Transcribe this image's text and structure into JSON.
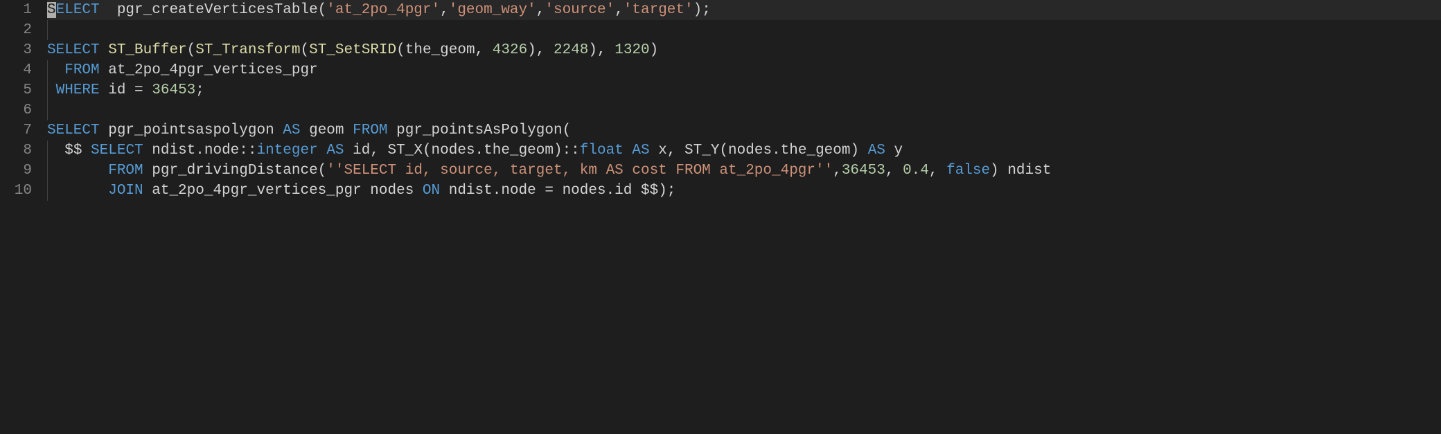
{
  "gutter": [
    "1",
    "2",
    "3",
    "4",
    "5",
    "6",
    "7",
    "8",
    "9",
    "10"
  ],
  "lines": {
    "l1": {
      "sel": "S",
      "t1": "ELECT",
      "t2": "  pgr_createVerticesTable(",
      "s1": "'at_2po_4pgr'",
      "c1": ",",
      "s2": "'geom_way'",
      "c2": ",",
      "s3": "'source'",
      "c3": ",",
      "s4": "'target'",
      "t3": ");"
    },
    "l3": {
      "k1": "SELECT",
      "f1": " ST_Buffer",
      "p1": "(",
      "f2": "ST_Transform",
      "p2": "(",
      "f3": "ST_SetSRID",
      "p3": "(the_geom, ",
      "n1": "4326",
      "p4": "), ",
      "n2": "2248",
      "p5": "), ",
      "n3": "1320",
      "p6": ")"
    },
    "l4": {
      "pad": "  ",
      "k1": "FROM",
      "t1": " at_2po_4pgr_vertices_pgr"
    },
    "l5": {
      "pad": " ",
      "k1": "WHERE",
      "t1": " id ",
      "op": "=",
      "sp": " ",
      "n1": "36453",
      "t2": ";"
    },
    "l7": {
      "k1": "SELECT",
      "t1": " pgr_pointsaspolygon ",
      "k2": "AS",
      "t2": " geom ",
      "k3": "FROM",
      "t3": " pgr_pointsAsPolygon("
    },
    "l8": {
      "pad": "  ",
      "t0": "$$ ",
      "k1": "SELECT",
      "t1": " ndist.node::",
      "ty1": "integer",
      "sp1": " ",
      "k2": "AS",
      "t2": " id, ST_X(nodes.the_geom)::",
      "ty2": "float",
      "sp2": " ",
      "k3": "AS",
      "t3": " x, ST_Y(nodes.the_geom) ",
      "k4": "AS",
      "t4": " y"
    },
    "l9": {
      "pad": "       ",
      "k1": "FROM",
      "t1": " pgr_drivingDistance(",
      "s1": "''SELECT id, source, target, km AS cost FROM at_2po_4pgr''",
      "t2": ",",
      "n1": "36453",
      "t3": ", ",
      "n2": "0.4",
      "t4": ", ",
      "k2": "false",
      "t5": ") ndist"
    },
    "l10": {
      "pad": "       ",
      "k1": "JOIN",
      "t1": " at_2po_4pgr_vertices_pgr nodes ",
      "k2": "ON",
      "t2": " ndist.node ",
      "op": "=",
      "t3": " nodes.id $$);"
    }
  }
}
